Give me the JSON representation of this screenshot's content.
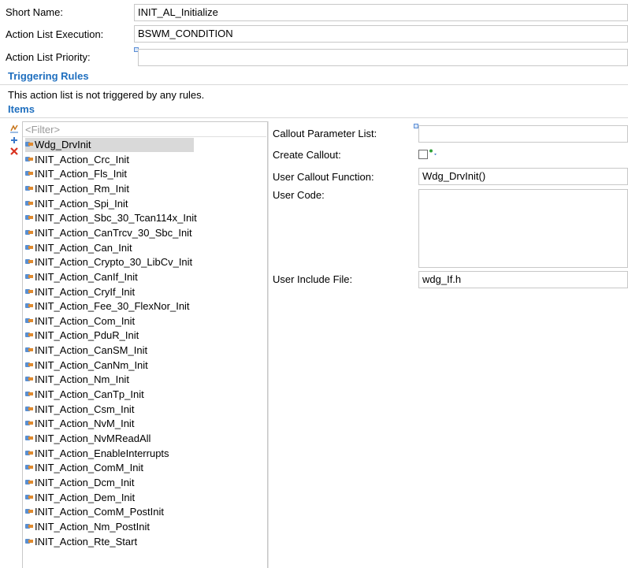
{
  "form": {
    "short_name_label": "Short Name:",
    "short_name_value": "INIT_AL_Initialize",
    "execution_label": "Action List Execution:",
    "execution_value": "BSWM_CONDITION",
    "priority_label": "Action List Priority:",
    "priority_value": ""
  },
  "triggering_rules": {
    "title": "Triggering Rules",
    "message": "This action list is not triggered by any rules."
  },
  "items": {
    "title": "Items",
    "filter_placeholder": "<Filter>",
    "list": [
      "Wdg_DrvInit",
      "INIT_Action_Crc_Init",
      "INIT_Action_Fls_Init",
      "INIT_Action_Rm_Init",
      "INIT_Action_Spi_Init",
      "INIT_Action_Sbc_30_Tcan114x_Init",
      "INIT_Action_CanTrcv_30_Sbc_Init",
      "INIT_Action_Can_Init",
      "INIT_Action_Crypto_30_LibCv_Init",
      "INIT_Action_CanIf_Init",
      "INIT_Action_CryIf_Init",
      "INIT_Action_Fee_30_FlexNor_Init",
      "INIT_Action_Com_Init",
      "INIT_Action_PduR_Init",
      "INIT_Action_CanSM_Init",
      "INIT_Action_CanNm_Init",
      "INIT_Action_Nm_Init",
      "INIT_Action_CanTp_Init",
      "INIT_Action_Csm_Init",
      "INIT_Action_NvM_Init",
      "INIT_Action_NvMReadAll",
      "INIT_Action_EnableInterrupts",
      "INIT_Action_ComM_Init",
      "INIT_Action_Dcm_Init",
      "INIT_Action_Dem_Init",
      "INIT_Action_ComM_PostInit",
      "INIT_Action_Nm_PostInit",
      "INIT_Action_Rte_Start"
    ],
    "selected": "Wdg_DrvInit"
  },
  "detail": {
    "callout_param_label": "Callout Parameter List:",
    "callout_param_value": "",
    "create_callout_label": "Create Callout:",
    "user_callout_label": "User Callout Function:",
    "user_callout_value": "Wdg_DrvInit()",
    "user_code_label": "User Code:",
    "user_code_value": "",
    "include_file_label": "User Include File:",
    "include_file_value": "wdg_If.h"
  },
  "icons": {
    "sort": "sort-icon",
    "add": "add-icon",
    "delete": "delete-icon",
    "item": "action-item-icon"
  },
  "colors": {
    "section_title": "#1f6fbf",
    "selection": "#d9d9d9"
  }
}
